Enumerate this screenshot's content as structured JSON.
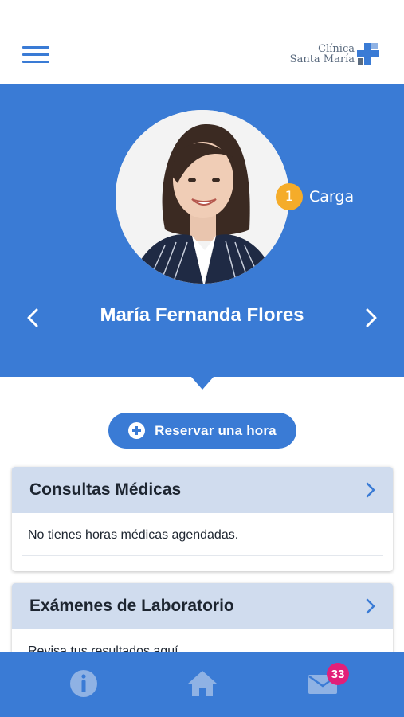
{
  "header": {
    "menu_icon": "hamburger-menu-icon",
    "logo": {
      "line1": "Clínica",
      "line2": "Santa María",
      "icon": "cross-icon",
      "color": "#5a6a7e"
    }
  },
  "profile": {
    "name": "María Fernanda Flores",
    "carga_count": "1",
    "carga_label": "Carga",
    "prev_icon": "chevron-left-icon",
    "next_icon": "chevron-right-icon",
    "background_color": "#3a7bd5",
    "badge_color": "#f5ac2a"
  },
  "actions": {
    "reserve_label": "Reservar una hora",
    "reserve_icon": "plus-circle-icon"
  },
  "cards": [
    {
      "title": "Consultas Médicas",
      "body": "No tienes horas médicas agendadas.",
      "icon": "chevron-right-icon"
    },
    {
      "title": "Exámenes de Laboratorio",
      "body": "Revisa tus resultados aquí",
      "icon": "chevron-right-icon"
    }
  ],
  "tabbar": {
    "items": [
      {
        "icon": "info-icon"
      },
      {
        "icon": "home-icon"
      },
      {
        "icon": "mail-icon",
        "badge": "33"
      }
    ],
    "badge_color": "#e21f79"
  }
}
